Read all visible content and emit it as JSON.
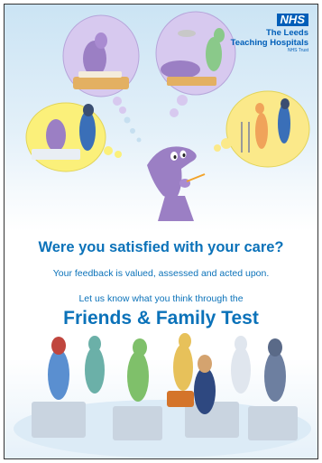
{
  "logo": {
    "badge": "NHS",
    "line1": "The Leeds",
    "line2": "Teaching Hospitals",
    "line3": "NHS Trust"
  },
  "headline": "Were you satisfied with your care?",
  "subline": "Your feedback is valued, assessed and acted upon.",
  "prompt": "Let us know what you think through the",
  "campaign": "Friends & Family Test",
  "colors": {
    "nhs_blue": "#005eb8",
    "text_blue": "#0b72b9",
    "character_purple": "#9b7fc4"
  }
}
